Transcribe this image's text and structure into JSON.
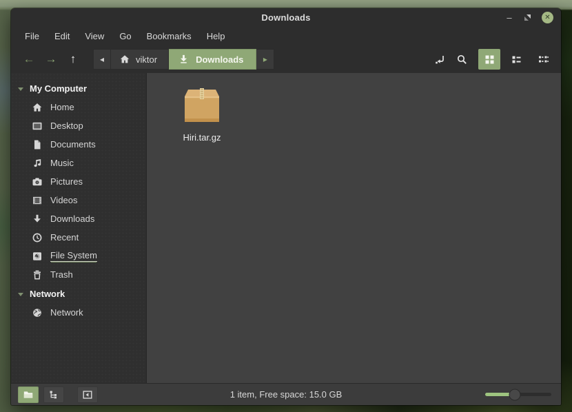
{
  "window": {
    "title": "Downloads",
    "controls": {
      "minimize_glyph": "–",
      "close_glyph": "✕"
    }
  },
  "menubar": {
    "items": [
      "File",
      "Edit",
      "View",
      "Go",
      "Bookmarks",
      "Help"
    ]
  },
  "toolbar": {
    "back_glyph": "←",
    "forward_glyph": "→",
    "up_glyph": "↑",
    "breadcrumbs": {
      "prev_glyph": "◂",
      "home_label": "viktor",
      "current_label": "Downloads",
      "next_glyph": "▸"
    },
    "active_view": "grid"
  },
  "sidebar": {
    "sections": [
      {
        "header": "My Computer",
        "items": [
          {
            "label": "Home",
            "icon": "home-icon"
          },
          {
            "label": "Desktop",
            "icon": "desktop-icon"
          },
          {
            "label": "Documents",
            "icon": "document-icon"
          },
          {
            "label": "Music",
            "icon": "music-note-icon"
          },
          {
            "label": "Pictures",
            "icon": "camera-icon"
          },
          {
            "label": "Videos",
            "icon": "film-icon"
          },
          {
            "label": "Downloads",
            "icon": "download-arrow-icon"
          },
          {
            "label": "Recent",
            "icon": "clock-icon"
          },
          {
            "label": "File System",
            "icon": "hard-disk-icon",
            "underlined": true
          },
          {
            "label": "Trash",
            "icon": "trash-icon"
          }
        ]
      },
      {
        "header": "Network",
        "items": [
          {
            "label": "Network",
            "icon": "globe-icon"
          }
        ]
      }
    ]
  },
  "content": {
    "files": [
      {
        "name": "Hiri.tar.gz",
        "icon": "archive-icon"
      }
    ]
  },
  "statusbar": {
    "text": "1 item, Free space: 15.0 GB",
    "zoom_percent": 45
  },
  "colors": {
    "accent_green": "#8fa876",
    "titlebar_bg": "#2d2d2d",
    "sidebar_bg": "#2f2f2f",
    "content_bg": "#414141",
    "statusbar_bg": "#3c3c3c",
    "archive_tan": "#cfa25f",
    "close_button": "#a4b884"
  }
}
